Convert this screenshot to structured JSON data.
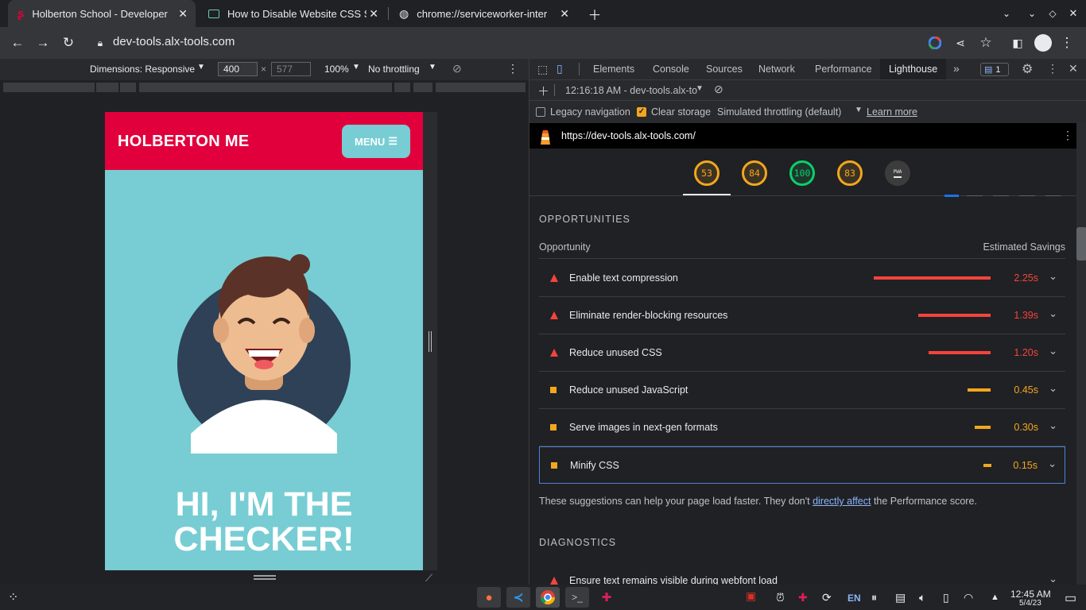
{
  "tabs": [
    {
      "title": "Holberton School - Developer",
      "active": true
    },
    {
      "title": "How to Disable Website CSS S",
      "active": false
    },
    {
      "title": "chrome://serviceworker-inter",
      "active": false
    }
  ],
  "toolbar": {
    "url": "dev-tools.alx-tools.com"
  },
  "device_bar": {
    "dimensions": "Dimensions: Responsive",
    "width": "400",
    "height": "577",
    "times": "×",
    "zoom": "100%",
    "throttling": "No throttling"
  },
  "page": {
    "brand": "HOLBERTON ME",
    "menu": "MENU",
    "hero_line1": "HI, I'M THE",
    "hero_line2": "CHECKER!"
  },
  "devtools": {
    "tabs": [
      "Elements",
      "Console",
      "Sources",
      "Network",
      "Performance",
      "Lighthouse"
    ],
    "issues_count": "1",
    "report_time": "12:16:18 AM - dev-tools.alx-to",
    "legacy_navigation": "Legacy navigation",
    "clear_storage": "Clear storage",
    "throttling": "Simulated throttling (default)",
    "learn_more": "Learn more",
    "report_url": "https://dev-tools.alx-tools.com/",
    "scores": [
      {
        "value": "53",
        "color": "#f2a71e"
      },
      {
        "value": "84",
        "color": "#f2a71e"
      },
      {
        "value": "100",
        "color": "#0cce6b"
      },
      {
        "value": "83",
        "color": "#f2a71e"
      },
      {
        "value": "PWA",
        "color": "#9aa0a6"
      }
    ],
    "opportunities_title": "OPPORTUNITIES",
    "col_opportunity": "Opportunity",
    "col_savings": "Estimated Savings",
    "opportunities": [
      {
        "label": "Enable text compression",
        "value": "2.25s",
        "severity": "fail",
        "savings_seconds": 2.25
      },
      {
        "label": "Eliminate render-blocking resources",
        "value": "1.39s",
        "severity": "fail",
        "savings_seconds": 1.39
      },
      {
        "label": "Reduce unused CSS",
        "value": "1.20s",
        "severity": "fail",
        "savings_seconds": 1.2
      },
      {
        "label": "Reduce unused JavaScript",
        "value": "0.45s",
        "severity": "average",
        "savings_seconds": 0.45
      },
      {
        "label": "Serve images in next-gen formats",
        "value": "0.30s",
        "severity": "average",
        "savings_seconds": 0.3
      },
      {
        "label": "Minify CSS",
        "value": "0.15s",
        "severity": "average",
        "savings_seconds": 0.15
      }
    ],
    "note_before": "These suggestions can help your page load faster. They don't ",
    "note_link": "directly affect",
    "note_after": " the Performance score.",
    "diagnostics_title": "DIAGNOSTICS",
    "diagnostic_first": "Ensure text remains visible during webfont load"
  },
  "taskbar": {
    "lang": "EN",
    "time": "12:45 AM",
    "date": "5/4/23"
  },
  "colors": {
    "fail": "#f4443c",
    "average": "#f2a71e",
    "pass": "#0cce6b",
    "brand_red": "#e1003c",
    "page_teal": "#77cdd3"
  }
}
